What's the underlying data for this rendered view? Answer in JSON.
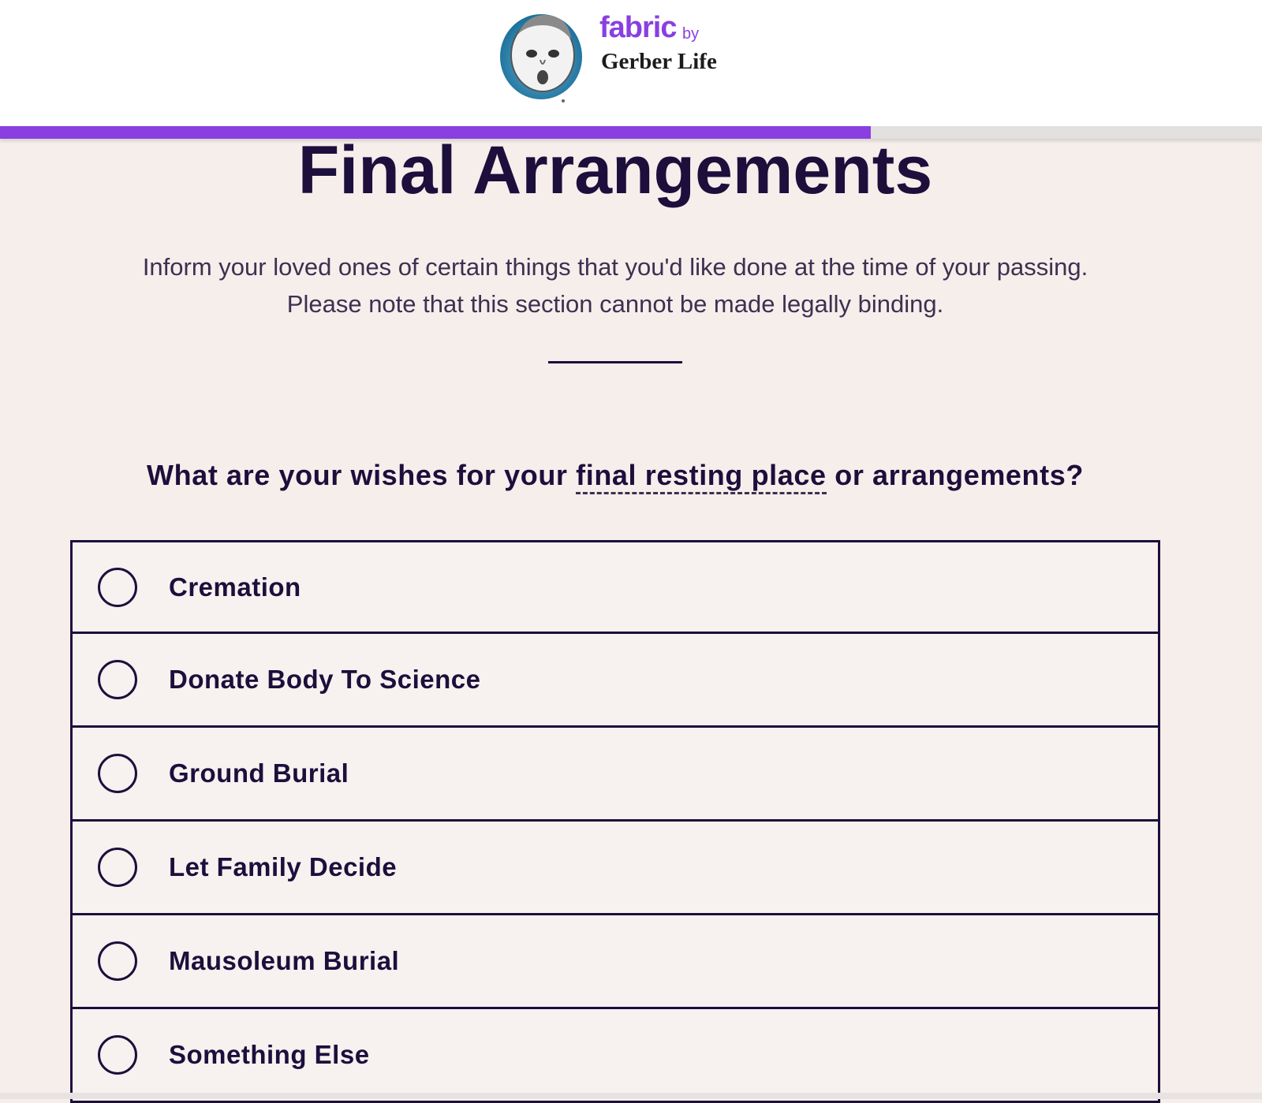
{
  "brand": {
    "name": "fabric",
    "by": "by",
    "company": "Gerber Life"
  },
  "progress": {
    "fraction": 0.69
  },
  "page": {
    "title": "Final Arrangements",
    "intro": "Inform your loved ones of certain things that you'd like done at the time of your passing. Please note that this section cannot be made legally binding."
  },
  "question": {
    "prefix": "What are your wishes for your ",
    "term": "final resting place",
    "suffix": " or arrangements?"
  },
  "options": [
    {
      "label": "Cremation"
    },
    {
      "label": "Donate Body To Science"
    },
    {
      "label": "Ground Burial"
    },
    {
      "label": "Let Family Decide"
    },
    {
      "label": "Mausoleum Burial"
    },
    {
      "label": "Something Else"
    }
  ],
  "colors": {
    "accent": "#8a3fe0",
    "text": "#1c0f3c",
    "background": "#f5eeeb"
  }
}
